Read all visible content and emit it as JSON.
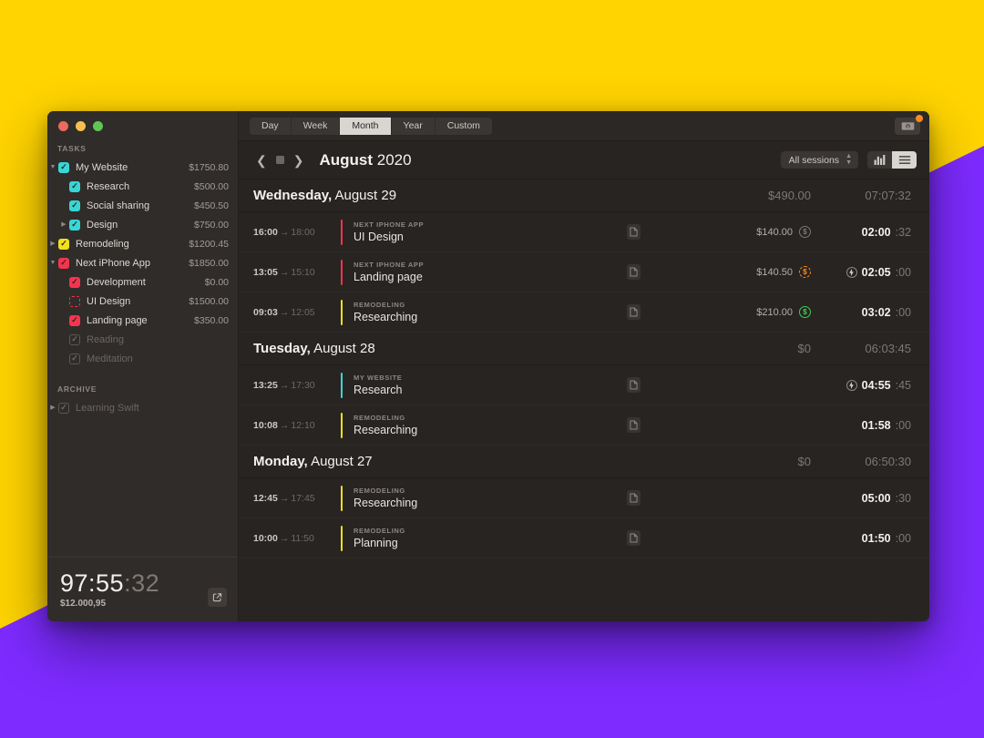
{
  "window": {
    "traffic_lights": [
      "close",
      "minimize",
      "maximize"
    ]
  },
  "sidebar": {
    "tasks_header": "TASKS",
    "archive_header": "ARCHIVE",
    "tasks": [
      {
        "label": "My Website",
        "amount": "$1750.80",
        "checkbox": "cyan",
        "level": 0,
        "disclosure": "down"
      },
      {
        "label": "Research",
        "amount": "$500.00",
        "checkbox": "cyan",
        "level": 1,
        "disclosure": ""
      },
      {
        "label": "Social sharing",
        "amount": "$450.50",
        "checkbox": "cyan",
        "level": 1,
        "disclosure": ""
      },
      {
        "label": "Design",
        "amount": "$750.00",
        "checkbox": "cyan",
        "level": 1,
        "disclosure": "right"
      },
      {
        "label": "Remodeling",
        "amount": "$1200.45",
        "checkbox": "yellow",
        "level": 0,
        "disclosure": "right"
      },
      {
        "label": "Next iPhone App",
        "amount": "$1850.00",
        "checkbox": "pink",
        "level": 0,
        "disclosure": "down"
      },
      {
        "label": "Development",
        "amount": "$0.00",
        "checkbox": "pink",
        "level": 1,
        "disclosure": ""
      },
      {
        "label": "UI Design",
        "amount": "$1500.00",
        "checkbox": "pink-empty",
        "level": 1,
        "disclosure": ""
      },
      {
        "label": "Landing page",
        "amount": "$350.00",
        "checkbox": "pink",
        "level": 1,
        "disclosure": ""
      },
      {
        "label": "Reading",
        "amount": "",
        "checkbox": "gray",
        "level": 1,
        "disclosure": "",
        "dim": true
      },
      {
        "label": "Meditation",
        "amount": "",
        "checkbox": "gray",
        "level": 1,
        "disclosure": "",
        "dim": true
      }
    ],
    "archive": [
      {
        "label": "Learning Swift",
        "amount": "",
        "checkbox": "gray",
        "level": 0,
        "disclosure": "right",
        "dim": true
      }
    ],
    "footer": {
      "timer_main": "97:55",
      "timer_sep": ":",
      "timer_sec": "32",
      "amount": "$12.000,95",
      "export_icon": "export-icon"
    }
  },
  "toolbar": {
    "segments": [
      {
        "label": "Day",
        "active": false
      },
      {
        "label": "Week",
        "active": false
      },
      {
        "label": "Month",
        "active": true
      },
      {
        "label": "Year",
        "active": false
      },
      {
        "label": "Custom",
        "active": false
      }
    ],
    "money_button_icon": "money-icon",
    "money_button_has_badge": true
  },
  "subbar": {
    "prev_icon": "chevron-left-icon",
    "stop_icon": "stop-square-icon",
    "next_icon": "chevron-right-icon",
    "period_month": "August",
    "period_year": "2020",
    "sessions_filter": "All sessions",
    "view_chart_icon": "bar-chart-icon",
    "view_list_icon": "list-icon",
    "view_active": "list"
  },
  "days": [
    {
      "weekday": "Wednesday,",
      "date": " August 29",
      "total_amount": "$490.00",
      "total_duration": "07:07:32",
      "sessions": [
        {
          "start": "16:00",
          "end": "18:00",
          "project": "NEXT IPHONE APP",
          "task": "UI Design",
          "color": "#f5344f",
          "amount": "$140.00",
          "badge": "gray",
          "dur_main": "02:00",
          "dur_sec": "32",
          "running": false
        },
        {
          "start": "13:05",
          "end": "15:10",
          "project": "NEXT IPHONE APP",
          "task": "Landing page",
          "color": "#f5344f",
          "amount": "$140.50",
          "badge": "orange",
          "dur_main": "02:05",
          "dur_sec": "00",
          "running": true
        },
        {
          "start": "09:03",
          "end": "12:05",
          "project": "REMODELING",
          "task": "Researching",
          "color": "#f3e01a",
          "amount": "$210.00",
          "badge": "green",
          "dur_main": "03:02",
          "dur_sec": "00",
          "running": false
        }
      ]
    },
    {
      "weekday": "Tuesday,",
      "date": " August 28",
      "total_amount": "$0",
      "total_duration": "06:03:45",
      "sessions": [
        {
          "start": "13:25",
          "end": "17:30",
          "project": "MY WEBSITE",
          "task": "Research",
          "color": "#38d6d6",
          "amount": "",
          "badge": "",
          "dur_main": "04:55",
          "dur_sec": "45",
          "running": true
        },
        {
          "start": "10:08",
          "end": "12:10",
          "project": "REMODELING",
          "task": "Researching",
          "color": "#f3e01a",
          "amount": "",
          "badge": "",
          "dur_main": "01:58",
          "dur_sec": "00",
          "running": false
        }
      ]
    },
    {
      "weekday": "Monday,",
      "date": " August 27",
      "total_amount": "$0",
      "total_duration": "06:50:30",
      "sessions": [
        {
          "start": "12:45",
          "end": "17:45",
          "project": "REMODELING",
          "task": "Researching",
          "color": "#f3e01a",
          "amount": "",
          "badge": "",
          "dur_main": "05:00",
          "dur_sec": "30",
          "running": false
        },
        {
          "start": "10:00",
          "end": "11:50",
          "project": "REMODELING",
          "task": "Planning",
          "color": "#f3e01a",
          "amount": "",
          "badge": "",
          "dur_main": "01:50",
          "dur_sec": "00",
          "running": false
        }
      ]
    }
  ],
  "colors": {
    "accent_cyan": "#38d6d6",
    "accent_yellow": "#f3e01a",
    "accent_pink": "#f5344f",
    "accent_orange": "#ff8a1e",
    "accent_green": "#3fcf52",
    "bg_yellow": "#ffd400",
    "bg_purple": "#7d2bff"
  }
}
